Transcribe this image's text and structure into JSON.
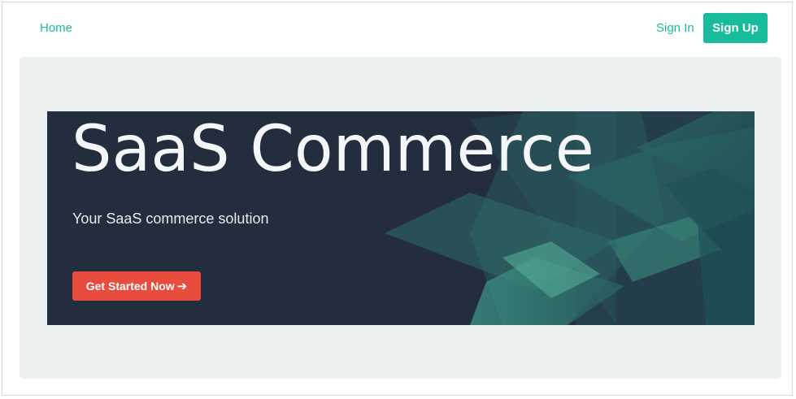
{
  "nav": {
    "home_label": "Home",
    "signin_label": "Sign In",
    "signup_label": "Sign Up"
  },
  "hero": {
    "title": "SaaS Commerce",
    "subtitle": "Your SaaS commerce solution",
    "cta_label": "Get Started Now",
    "cta_arrow": "➔"
  },
  "colors": {
    "accent": "#18bc9c",
    "cta": "#e74c3c",
    "hero_bg": "#232d3e",
    "jumbotron_bg": "#ecf0f1"
  }
}
